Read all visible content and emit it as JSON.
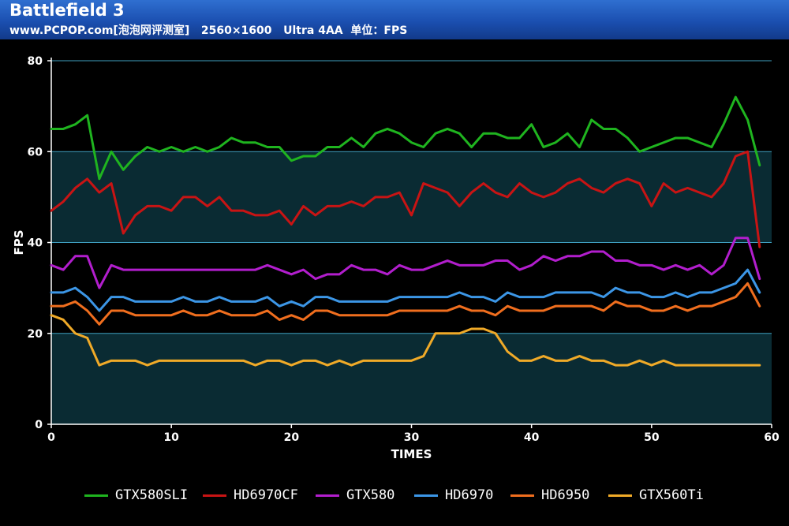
{
  "header": {
    "title": "Battlefield 3",
    "subtitle": "www.PCPOP.com[泡泡网评测室]   2560×1600   Ultra 4AA  单位：FPS"
  },
  "colors": {
    "header_top": "#2f6fd0",
    "header_bottom": "#123a8a",
    "plot_band": "#0a2b33",
    "grid_line": "#3f9fc0",
    "axis": "#ffffff",
    "background": "#000000"
  },
  "chart_data": {
    "type": "line",
    "xlabel": "TIMES",
    "ylabel": "FPS",
    "xlim": [
      0,
      60
    ],
    "ylim": [
      0,
      80
    ],
    "xticks": [
      0,
      10,
      20,
      30,
      40,
      50,
      60
    ],
    "yticks": [
      0,
      20,
      40,
      60,
      80
    ],
    "grid": "horizontal",
    "legend_position": "bottom",
    "x": [
      0,
      1,
      2,
      3,
      4,
      5,
      6,
      7,
      8,
      9,
      10,
      11,
      12,
      13,
      14,
      15,
      16,
      17,
      18,
      19,
      20,
      21,
      22,
      23,
      24,
      25,
      26,
      27,
      28,
      29,
      30,
      31,
      32,
      33,
      34,
      35,
      36,
      37,
      38,
      39,
      40,
      41,
      42,
      43,
      44,
      45,
      46,
      47,
      48,
      49,
      50,
      51,
      52,
      53,
      54,
      55,
      56,
      57,
      58,
      59
    ],
    "series": [
      {
        "name": "GTX580SLI",
        "color": "#1fb41f",
        "values": [
          65,
          65,
          66,
          68,
          54,
          60,
          56,
          59,
          61,
          60,
          61,
          60,
          61,
          60,
          61,
          63,
          62,
          62,
          61,
          61,
          58,
          59,
          59,
          61,
          61,
          63,
          61,
          64,
          65,
          64,
          62,
          61,
          64,
          65,
          64,
          61,
          64,
          64,
          63,
          63,
          66,
          61,
          62,
          64,
          61,
          67,
          65,
          65,
          63,
          60,
          61,
          62,
          63,
          63,
          62,
          61,
          66,
          72,
          67,
          57
        ]
      },
      {
        "name": "HD6970CF",
        "color": "#c81414",
        "values": [
          47,
          49,
          52,
          54,
          51,
          53,
          42,
          46,
          48,
          48,
          47,
          50,
          50,
          48,
          50,
          47,
          47,
          46,
          46,
          47,
          44,
          48,
          46,
          48,
          48,
          49,
          48,
          50,
          50,
          51,
          46,
          53,
          52,
          51,
          48,
          51,
          53,
          51,
          50,
          53,
          51,
          50,
          51,
          53,
          54,
          52,
          51,
          53,
          54,
          53,
          48,
          53,
          51,
          52,
          51,
          50,
          53,
          59,
          60,
          39
        ]
      },
      {
        "name": "GTX580",
        "color": "#b21ecd",
        "values": [
          35,
          34,
          37,
          37,
          30,
          35,
          34,
          34,
          34,
          34,
          34,
          34,
          34,
          34,
          34,
          34,
          34,
          34,
          35,
          34,
          33,
          34,
          32,
          33,
          33,
          35,
          34,
          34,
          33,
          35,
          34,
          34,
          35,
          36,
          35,
          35,
          35,
          36,
          36,
          34,
          35,
          37,
          36,
          37,
          37,
          38,
          38,
          36,
          36,
          35,
          35,
          34,
          35,
          34,
          35,
          33,
          35,
          41,
          41,
          32
        ]
      },
      {
        "name": "HD6970",
        "color": "#3c96e6",
        "values": [
          29,
          29,
          30,
          28,
          25,
          28,
          28,
          27,
          27,
          27,
          27,
          28,
          27,
          27,
          28,
          27,
          27,
          27,
          28,
          26,
          27,
          26,
          28,
          28,
          27,
          27,
          27,
          27,
          27,
          28,
          28,
          28,
          28,
          28,
          29,
          28,
          28,
          27,
          29,
          28,
          28,
          28,
          29,
          29,
          29,
          29,
          28,
          30,
          29,
          29,
          28,
          28,
          29,
          28,
          29,
          29,
          30,
          31,
          34,
          29
        ]
      },
      {
        "name": "HD6950",
        "color": "#f06e1e",
        "values": [
          26,
          26,
          27,
          25,
          22,
          25,
          25,
          24,
          24,
          24,
          24,
          25,
          24,
          24,
          25,
          24,
          24,
          24,
          25,
          23,
          24,
          23,
          25,
          25,
          24,
          24,
          24,
          24,
          24,
          25,
          25,
          25,
          25,
          25,
          26,
          25,
          25,
          24,
          26,
          25,
          25,
          25,
          26,
          26,
          26,
          26,
          25,
          27,
          26,
          26,
          25,
          25,
          26,
          25,
          26,
          26,
          27,
          28,
          31,
          26
        ]
      },
      {
        "name": "GTX560Ti",
        "color": "#f0aa28",
        "values": [
          24,
          23,
          20,
          19,
          13,
          14,
          14,
          14,
          13,
          14,
          14,
          14,
          14,
          14,
          14,
          14,
          14,
          13,
          14,
          14,
          13,
          14,
          14,
          13,
          14,
          13,
          14,
          14,
          14,
          14,
          14,
          15,
          20,
          20,
          20,
          21,
          21,
          20,
          16,
          14,
          14,
          15,
          14,
          14,
          15,
          14,
          14,
          13,
          13,
          14,
          13,
          14,
          13,
          13,
          13,
          13,
          13,
          13,
          13,
          13
        ]
      }
    ]
  }
}
